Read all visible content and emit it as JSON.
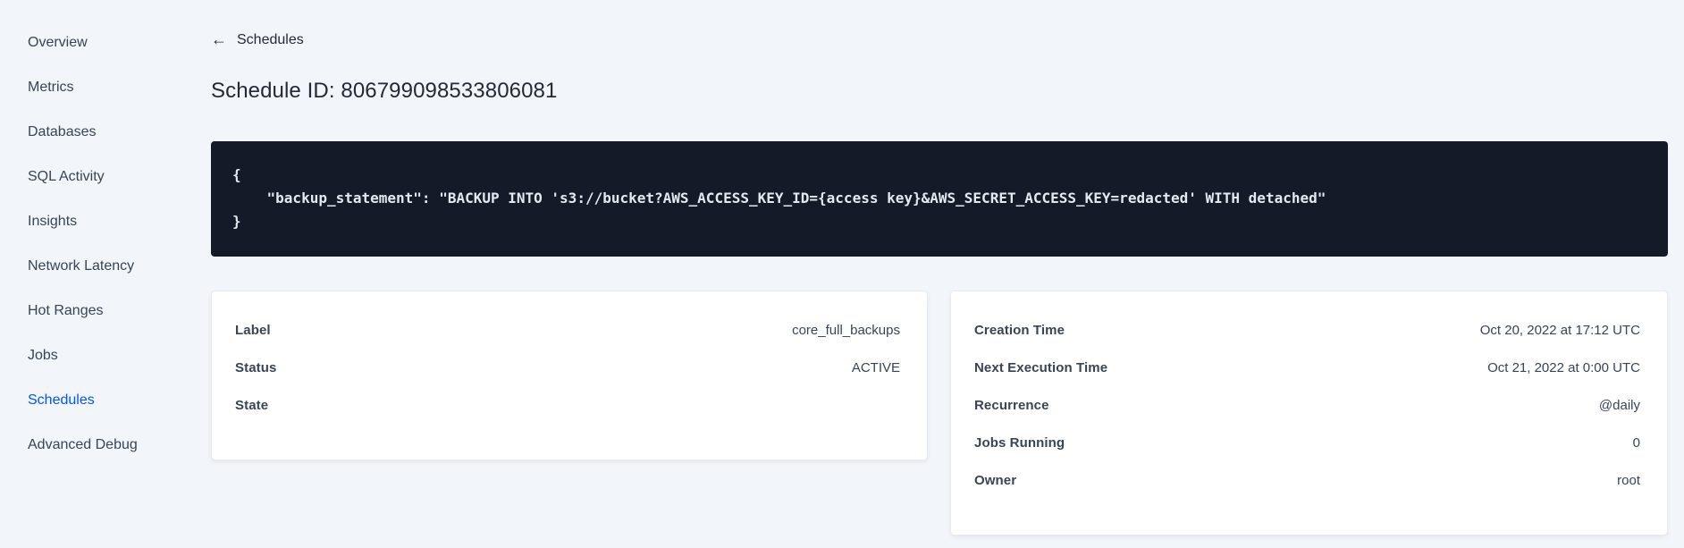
{
  "colors": {
    "background": "#f2f5f9",
    "text": "#394455",
    "heading": "#242a35",
    "accent_link": "#0055ff",
    "code_background": "#151a29",
    "code_text": "#e4e9f0",
    "card_background": "#ffffff"
  },
  "sidebar": {
    "items": [
      {
        "label": "Overview",
        "active": false
      },
      {
        "label": "Metrics",
        "active": false
      },
      {
        "label": "Databases",
        "active": false
      },
      {
        "label": "SQL Activity",
        "active": false
      },
      {
        "label": "Insights",
        "active": false
      },
      {
        "label": "Network Latency",
        "active": false
      },
      {
        "label": "Hot Ranges",
        "active": false
      },
      {
        "label": "Jobs",
        "active": false
      },
      {
        "label": "Schedules",
        "active": true
      },
      {
        "label": "Advanced Debug",
        "active": false
      }
    ]
  },
  "header": {
    "back_icon": "arrow-left",
    "back_label": "Schedules",
    "title": "Schedule ID: 806799098533806081"
  },
  "code_block": {
    "lines": [
      "{",
      "    \"backup_statement\": \"BACKUP INTO 's3://bucket?AWS_ACCESS_KEY_ID={access key}&AWS_SECRET_ACCESS_KEY=redacted' WITH detached\"",
      "}"
    ]
  },
  "schedule_summary_card": {
    "rows": [
      {
        "label": "Label",
        "value": "core_full_backups"
      },
      {
        "label": "Status",
        "value": "ACTIVE"
      },
      {
        "label": "State",
        "value": ""
      }
    ]
  },
  "schedule_timing_card": {
    "rows": [
      {
        "label": "Creation Time",
        "value": "Oct 20, 2022 at 17:12 UTC"
      },
      {
        "label": "Next Execution Time",
        "value": "Oct 21, 2022 at 0:00 UTC"
      },
      {
        "label": "Recurrence",
        "value": "@daily"
      },
      {
        "label": "Jobs Running",
        "value": "0"
      },
      {
        "label": "Owner",
        "value": "root"
      }
    ]
  }
}
